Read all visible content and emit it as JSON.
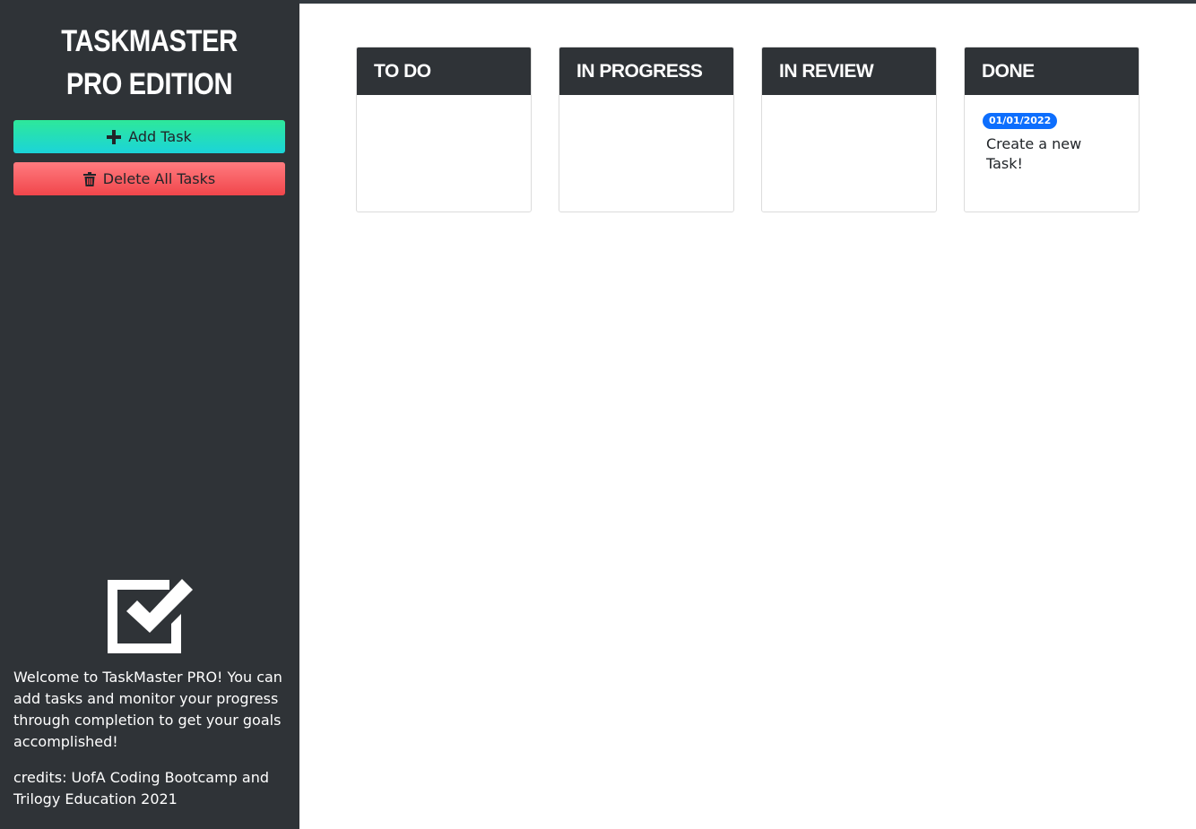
{
  "app": {
    "title": "TaskMaster PRO Edition"
  },
  "sidebar": {
    "add_task_label": "Add Task",
    "delete_all_label": "Delete All Tasks",
    "welcome_text": "Welcome to TaskMaster PRO! You can add tasks and monitor your progress through completion to get your goals accomplished!",
    "credits_text": "credits: UofA Coding Bootcamp and Trilogy Education 2021",
    "logo_icon": "checkbox-checked-icon",
    "add_icon": "plus-icon",
    "delete_icon": "trash-icon"
  },
  "board": {
    "columns": [
      {
        "title": "To Do",
        "tasks": []
      },
      {
        "title": "In Progress",
        "tasks": []
      },
      {
        "title": "In Review",
        "tasks": []
      },
      {
        "title": "Done",
        "tasks": [
          {
            "date": "01/01/2022",
            "text": "Create a new Task!"
          }
        ]
      }
    ]
  },
  "colors": {
    "sidebar_bg": "#2f3337",
    "add_button_top": "#2ee89a",
    "add_button_bottom": "#1bd4d9",
    "delete_button_top": "#ff7b7f",
    "delete_button_bottom": "#f1464b",
    "badge": "#0d6efd"
  }
}
